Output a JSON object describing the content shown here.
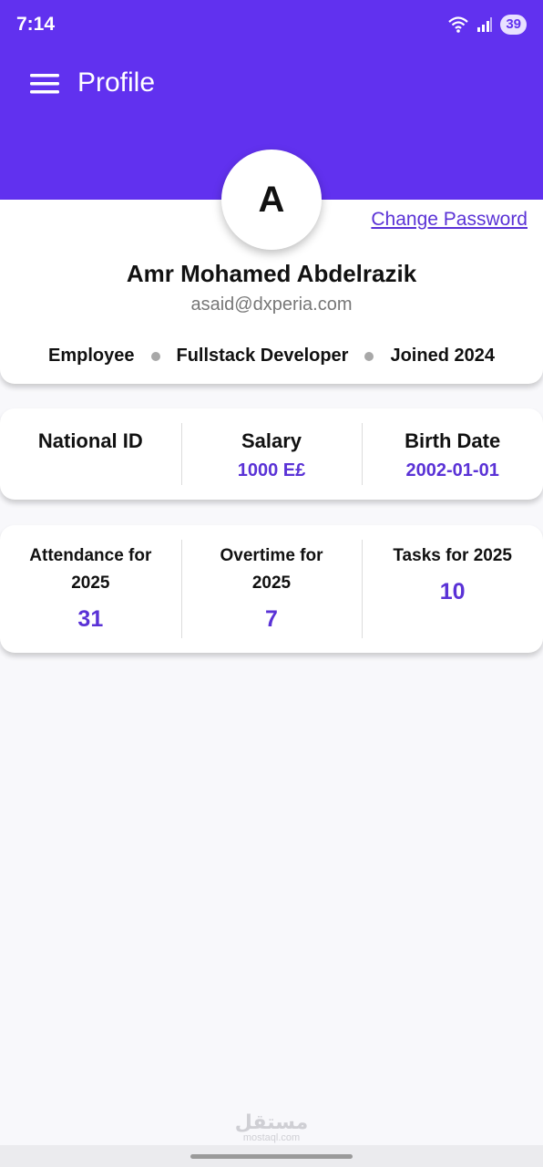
{
  "status_bar": {
    "time": "7:14",
    "battery": "39"
  },
  "header": {
    "title": "Profile"
  },
  "profile": {
    "avatar_letter": "A",
    "change_password": "Change Password",
    "name": "Amr Mohamed Abdelrazik",
    "email": "asaid@dxperia.com",
    "role": "Employee",
    "position": "Fullstack Developer",
    "joined": "Joined 2024"
  },
  "info": [
    {
      "label": "National ID",
      "value": ""
    },
    {
      "label": "Salary",
      "value": "1000 E£"
    },
    {
      "label": "Birth Date",
      "value": "2002-01-01"
    }
  ],
  "stats": [
    {
      "label": "Attendance for 2025",
      "value": "31"
    },
    {
      "label": "Overtime for 2025",
      "value": "7"
    },
    {
      "label": "Tasks for 2025",
      "value": "10"
    }
  ],
  "watermark": {
    "arabic": "مستقل",
    "latin": "mostaql.com"
  },
  "colors": {
    "primary": "#6131ef",
    "accent": "#5a32d6"
  }
}
